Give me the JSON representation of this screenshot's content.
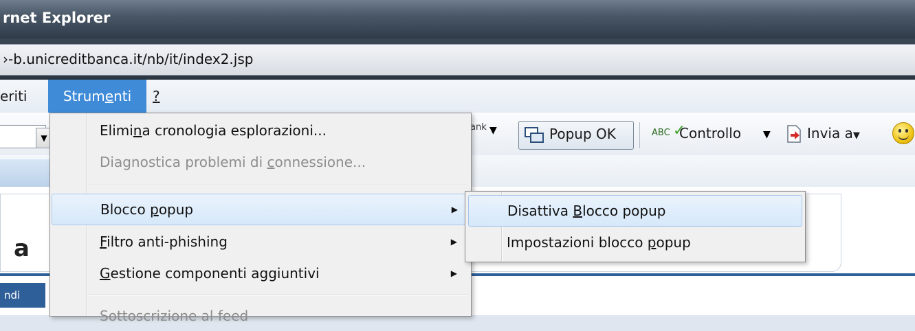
{
  "window": {
    "title": "rnet Explorer",
    "url": "›-b.unicreditbanca.it/nb/it/index2.jsp"
  },
  "menubar": {
    "items": [
      {
        "label": "eriti"
      },
      {
        "label_pre": "Strum",
        "label_key": "e",
        "label_post": "nti"
      },
      {
        "label": "?"
      }
    ]
  },
  "toolbar": {
    "bank_label": "ank",
    "popup_ok_label": "Popup OK",
    "controllo_label": "Controllo",
    "controllo_icon_text": "ABC",
    "invia_label": "Invia a"
  },
  "dropdown": {
    "items": [
      {
        "pre": "Elimi",
        "key": "n",
        "post": "a cronologia esplorazioni...",
        "state": "enabled"
      },
      {
        "pre": "Diagnostica problemi di ",
        "key": "c",
        "post": "onnessione...",
        "state": "disabled"
      },
      {
        "pre": "Blocco ",
        "key": "p",
        "post": "opup",
        "state": "highlighted",
        "submenu": true
      },
      {
        "pre": "",
        "key": "F",
        "post": "iltro anti-phishing",
        "state": "enabled",
        "submenu": true
      },
      {
        "pre": "",
        "key": "G",
        "post": "estione componenti aggiuntivi",
        "state": "enabled",
        "submenu": true
      },
      {
        "pre": "Sottoscrizione al feed",
        "key": "",
        "post": "",
        "state": "disabled"
      }
    ]
  },
  "submenu": {
    "items": [
      {
        "pre": "Disattiva ",
        "key": "B",
        "post": "locco popup",
        "state": "highlighted"
      },
      {
        "pre": "Impostazioni blocco ",
        "key": "p",
        "post": "opup",
        "state": "enabled"
      }
    ]
  },
  "page": {
    "glyph": "a",
    "nav_tab_label": "ndi"
  },
  "colors": {
    "menu_highlight": "#3f8bd8",
    "item_hover": "#d6e8fa",
    "nav_blue": "#2e5f98"
  }
}
